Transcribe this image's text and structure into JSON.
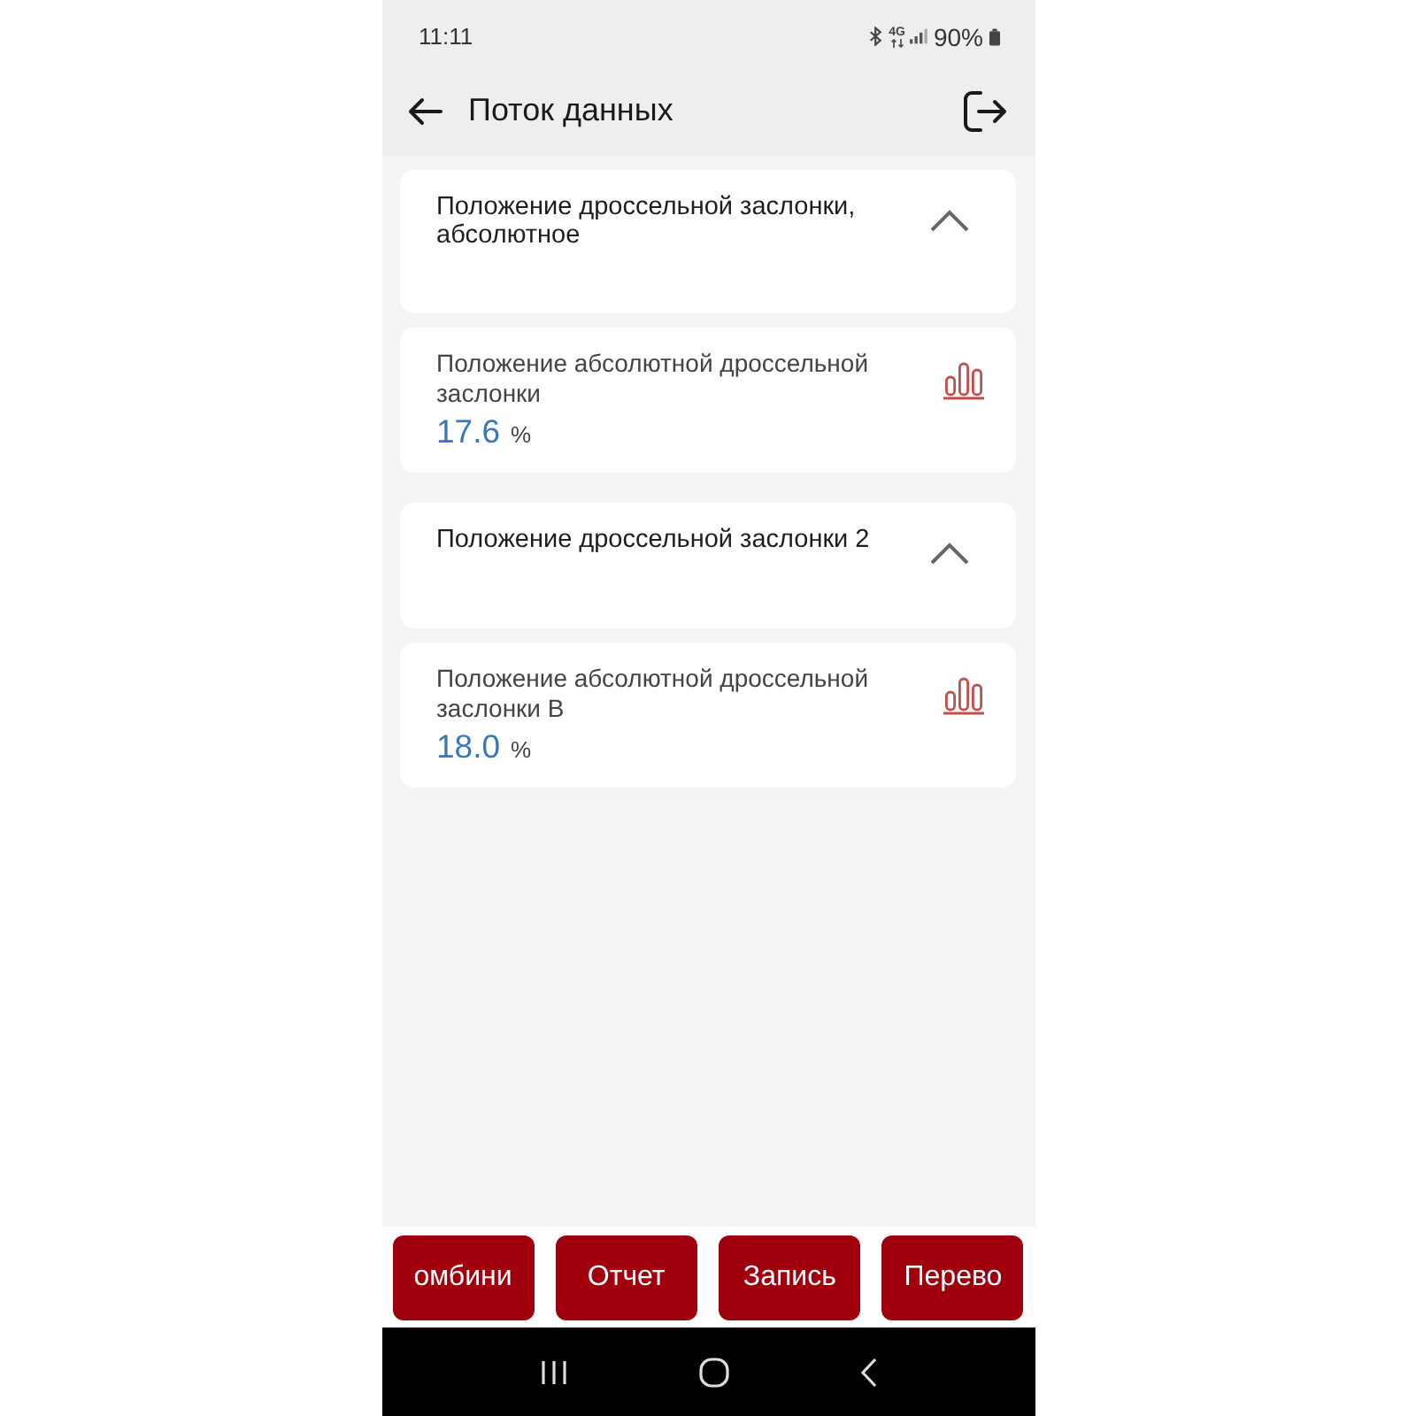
{
  "status_bar": {
    "time": "11:11",
    "network": "4G",
    "battery": "90%"
  },
  "header": {
    "title": "Поток данных"
  },
  "groups": [
    {
      "title": "Положение дроссельной заслонки, абсолютное",
      "expanded": true,
      "items": [
        {
          "name": "Положение абсолютной дроссельной заслонки",
          "value": "17.6",
          "unit": "%"
        }
      ]
    },
    {
      "title": "Положение дроссельной заслонки 2",
      "expanded": true,
      "items": [
        {
          "name": "Положение абсолютной дроссельной заслонки B",
          "value": "18.0",
          "unit": "%"
        }
      ]
    }
  ],
  "actions": [
    {
      "label": "омбини"
    },
    {
      "label": "Отчет"
    },
    {
      "label": "Запись"
    },
    {
      "label": "Перево"
    }
  ]
}
